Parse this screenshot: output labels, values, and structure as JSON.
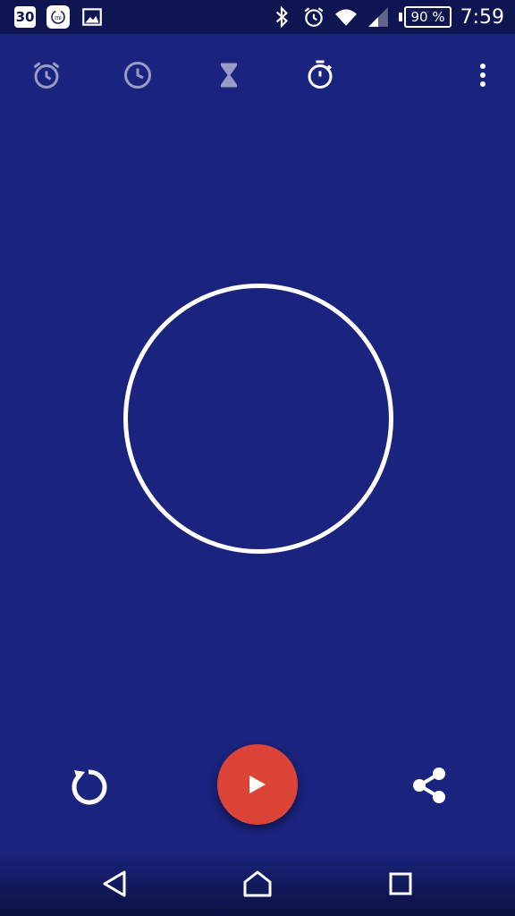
{
  "status_bar": {
    "left_icons": [
      "calendar-icon",
      "mi-icon",
      "image-icon"
    ],
    "calendar_date": "30",
    "right_icons": [
      "bluetooth-icon",
      "alarm-icon",
      "wifi-icon",
      "signal-icon"
    ],
    "battery_text": "90 %",
    "time": "7:59"
  },
  "tabs": [
    {
      "icon": "alarm-clock-icon",
      "active": false
    },
    {
      "icon": "clock-icon",
      "active": false
    },
    {
      "icon": "hourglass-icon",
      "active": false
    },
    {
      "icon": "stopwatch-icon",
      "active": true
    }
  ],
  "menu_icon": "more-vertical-icon",
  "controls": {
    "reset_icon": "reset-icon",
    "play_icon": "play-icon",
    "share_icon": "share-icon"
  },
  "colors": {
    "background": "#1a237e",
    "status_bar": "#0e1550",
    "fab": "#db4437",
    "foreground": "#ffffff"
  },
  "nav": [
    "back-icon",
    "home-icon",
    "recents-icon"
  ]
}
